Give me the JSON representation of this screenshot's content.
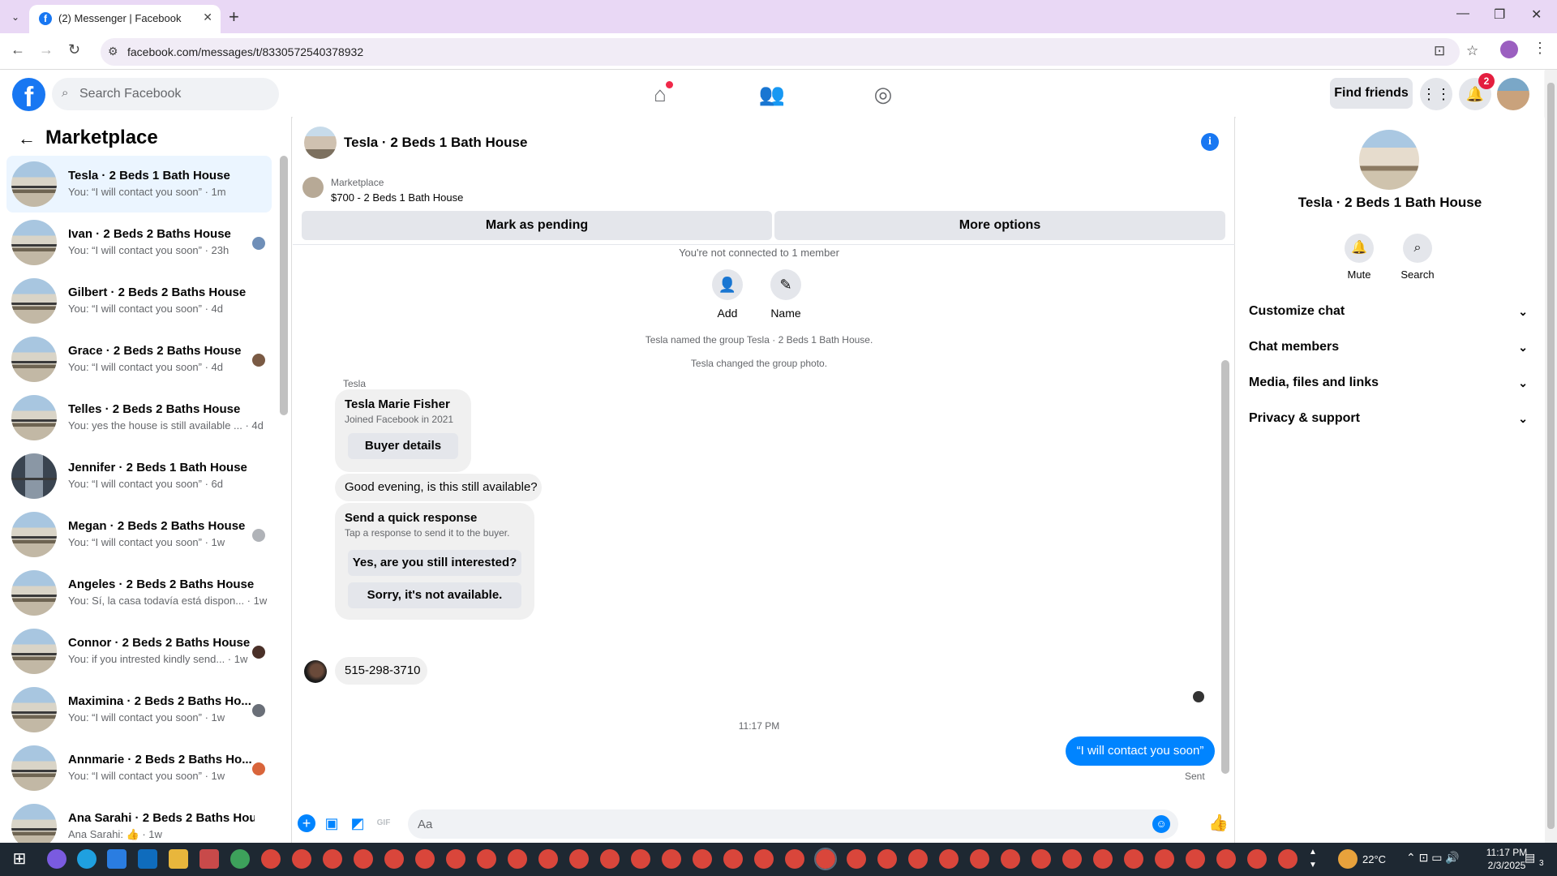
{
  "browser": {
    "tab_title": "(2) Messenger | Facebook",
    "url": "facebook.com/messages/t/8330572540378932"
  },
  "header": {
    "search_placeholder": "Search Facebook",
    "find_friends": "Find friends",
    "notification_count": "2"
  },
  "sidebar": {
    "title": "Marketplace",
    "conversations": [
      {
        "name": "Tesla · 2 Beds 1 Bath House",
        "preview": "You: “I will contact you soon” · 1m"
      },
      {
        "name": "Ivan · 2 Beds 2 Baths House",
        "preview": "You: “I will contact you soon” · 23h"
      },
      {
        "name": "Gilbert · 2 Beds 2 Baths House",
        "preview": "You: “I will contact you soon” · 4d"
      },
      {
        "name": "Grace · 2 Beds 2 Baths House",
        "preview": "You: “I will contact you soon” · 4d"
      },
      {
        "name": "Telles · 2 Beds 2 Baths House",
        "preview": "You: yes the house is still available ... · 4d"
      },
      {
        "name": "Jennifer · 2 Beds 1 Bath House",
        "preview": "You: “I will contact you soon” · 6d"
      },
      {
        "name": "Megan · 2 Beds 2 Baths House",
        "preview": "You: “I will contact you soon” · 1w"
      },
      {
        "name": "Angeles · 2 Beds 2 Baths House",
        "preview": "You: Sí, la casa todavía está dispon... · 1w"
      },
      {
        "name": "Connor · 2 Beds 2 Baths House",
        "preview": "You: if you intrested kindly send... · 1w"
      },
      {
        "name": "Maximina · 2 Beds 2 Baths Ho...",
        "preview": "You: “I will contact you soon” · 1w"
      },
      {
        "name": "Annmarie · 2 Beds 2 Baths Ho...",
        "preview": "You: “I will contact you soon” · 1w"
      },
      {
        "name": "Ana Sarahi · 2 Beds 2 Baths Hou...",
        "preview": "Ana Sarahi: 👍 · 1w"
      }
    ]
  },
  "chat": {
    "title": "Tesla · 2 Beds 1 Bath House",
    "marketplace_label": "Marketplace",
    "listing": "$700 - 2 Beds 1 Bath House",
    "mark_pending": "Mark as pending",
    "more_options": "More options",
    "not_connected": "You're not connected to 1 member",
    "add_label": "Add",
    "name_label": "Name",
    "event_1": "Tesla named the group Tesla · 2 Beds 1 Bath House.",
    "event_2": "Tesla changed the group photo.",
    "sender": "Tesla",
    "profile_name": "Tesla Marie Fisher",
    "profile_joined": "Joined Facebook in 2021",
    "buyer_details": "Buyer details",
    "msg_1": "Good evening, is this still available?",
    "quick_title": "Send a quick response",
    "quick_sub": "Tap a response to send it to the buyer.",
    "quick_1": "Yes, are you still interested?",
    "quick_2": "Sorry, it's not available.",
    "msg_2": "515-298-3710",
    "timestamp": "11:17 PM",
    "out_msg": "“I will contact you soon”",
    "sent": "Sent",
    "composer_placeholder": "Aa"
  },
  "info_panel": {
    "title": "Tesla · 2 Beds 1 Bath House",
    "mute": "Mute",
    "search": "Search",
    "sections": [
      "Customize chat",
      "Chat members",
      "Media, files and links",
      "Privacy & support"
    ]
  },
  "taskbar": {
    "temperature": "22°C",
    "time": "11:17 PM",
    "date": "2/3/2025",
    "notif": "3"
  },
  "colors": {
    "facebook_blue": "#1877f2",
    "messenger_blue": "#0084ff",
    "tab_bar": "#e9d8f5"
  }
}
